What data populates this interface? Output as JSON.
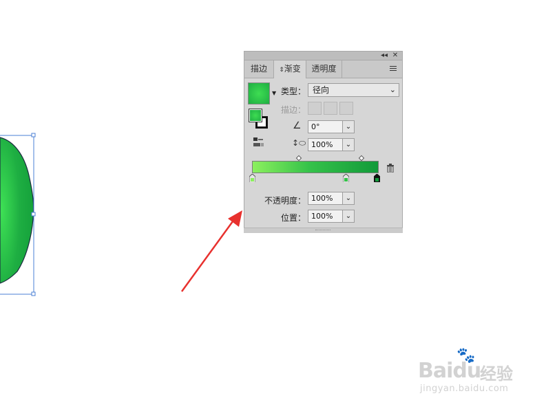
{
  "panel": {
    "tabs": [
      {
        "label": "描边"
      },
      {
        "label": "渐变"
      },
      {
        "label": "透明度"
      }
    ],
    "titlebar": {
      "collapse": "◂◂",
      "close": "✕"
    },
    "type_label": "类型：",
    "type_value": "径向",
    "stroke_label": "描边：",
    "angle_value": "0°",
    "aspect_value": "100%",
    "opacity_label": "不透明度：",
    "opacity_value": "100%",
    "location_label": "位置：",
    "location_value": "100%"
  },
  "gradient": {
    "stops": [
      {
        "color": "#8cf05e",
        "location": 0
      },
      {
        "color": "#35c24a",
        "location": 74
      },
      {
        "color": "#129a3a",
        "location": 100
      }
    ],
    "midpoints": [
      37,
      87
    ],
    "fill_center": "#3edd52",
    "fill_edge": "#1aa83f"
  },
  "watermark": {
    "brand": "Baidu",
    "brand_cn": "经验",
    "url": "jingyan.baidu.com"
  },
  "colors": {
    "arrow": "#e8312e",
    "object_fill": "#1aa83f"
  }
}
